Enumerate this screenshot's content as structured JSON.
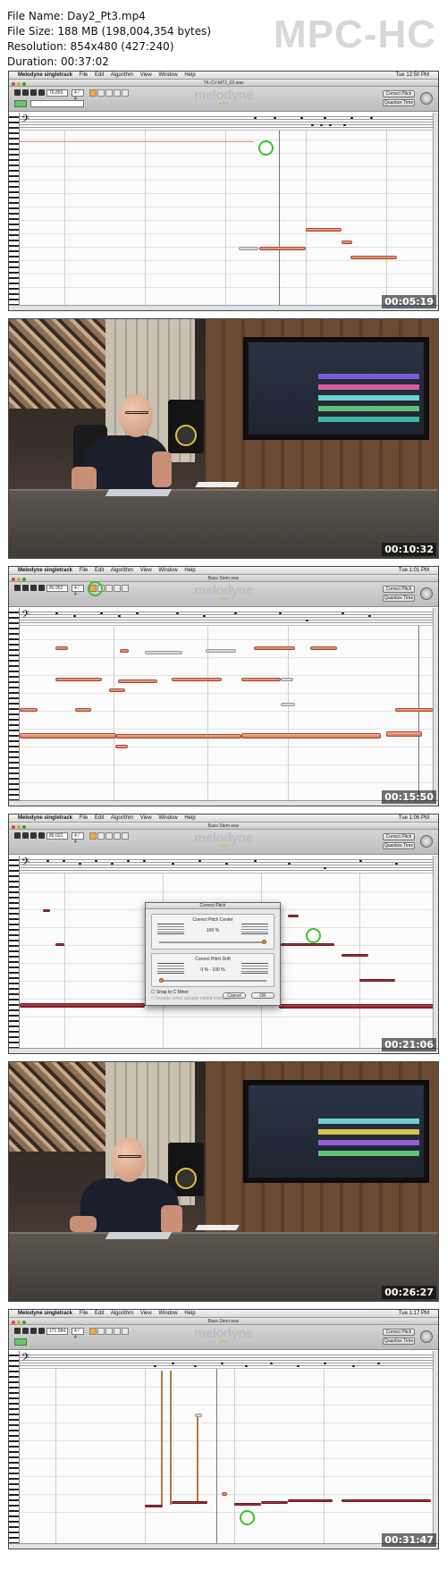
{
  "header": {
    "file_name": "File Name: Day2_Pt3.mp4",
    "file_size": "File Size: 188 MB (198,004,354 bytes)",
    "resolution": "Resolution: 854x480 (427:240)",
    "duration": "Duration: 00:37:02",
    "logo": "MPC-HC"
  },
  "frames": [
    {
      "timestamp": "00:05:19",
      "menu": [
        "Melodyne singletrack",
        "File",
        "Edit",
        "Algorithm",
        "View",
        "Window",
        "Help"
      ],
      "clock": "Tue 12:50 PM",
      "window_title": "TK-CV-MT2_03.wav",
      "tempo": "76.859",
      "meter": "4 / 4",
      "buttons": [
        "Correct Pitch",
        "Quantize Time"
      ],
      "logo": "melodyne",
      "logo_sub": "editor"
    },
    {
      "timestamp": "00:10:32"
    },
    {
      "timestamp": "00:15:50",
      "menu": [
        "Melodyne singletrack",
        "File",
        "Edit",
        "Algorithm",
        "View",
        "Window",
        "Help"
      ],
      "clock": "Tue 1:01 PM",
      "window_title": "Bass Stem.wav",
      "tempo": "80.952",
      "meter": "4 / 4",
      "buttons": [
        "Correct Pitch",
        "Quantize Time"
      ],
      "logo": "melodyne",
      "logo_sub": "editor"
    },
    {
      "timestamp": "00:21:06",
      "menu": [
        "Melodyne singletrack",
        "File",
        "Edit",
        "Algorithm",
        "View",
        "Window",
        "Help"
      ],
      "clock": "Tue 1:06 PM",
      "window_title": "Bass Stem.wav",
      "tempo": "80.022",
      "meter": "4 / 4",
      "buttons": [
        "Correct Pitch",
        "Quantize Time"
      ],
      "logo": "melodyne",
      "logo_sub": "editor",
      "dialog": {
        "title": "Correct Pitch",
        "section1": "Correct Pitch Center",
        "value1": "100 %",
        "section2": "Correct Pitch Drift",
        "value2": "0 % - 100 %",
        "checkbox": "Snap to C Minor",
        "checkbox2": "Include notes already edited manually",
        "cancel": "Cancel",
        "ok": "OK"
      }
    },
    {
      "timestamp": "00:26:27"
    },
    {
      "timestamp": "00:31:47",
      "menu": [
        "Melodyne singletrack",
        "File",
        "Edit",
        "Algorithm",
        "View",
        "Window",
        "Help"
      ],
      "clock": "Tue 1:17 PM",
      "window_title": "Bass Stem.wav",
      "tempo": "171.984",
      "meter": "4 / 4",
      "buttons": [
        "Correct Pitch",
        "Quantize Time"
      ],
      "logo": "melodyne",
      "logo_sub": "editor"
    }
  ],
  "colors": {
    "note_orange": "#d77455",
    "note_dark_red": "#8a1f2b",
    "highlight_circle": "#39c42e",
    "pitch_stick": "#f2b46a"
  }
}
